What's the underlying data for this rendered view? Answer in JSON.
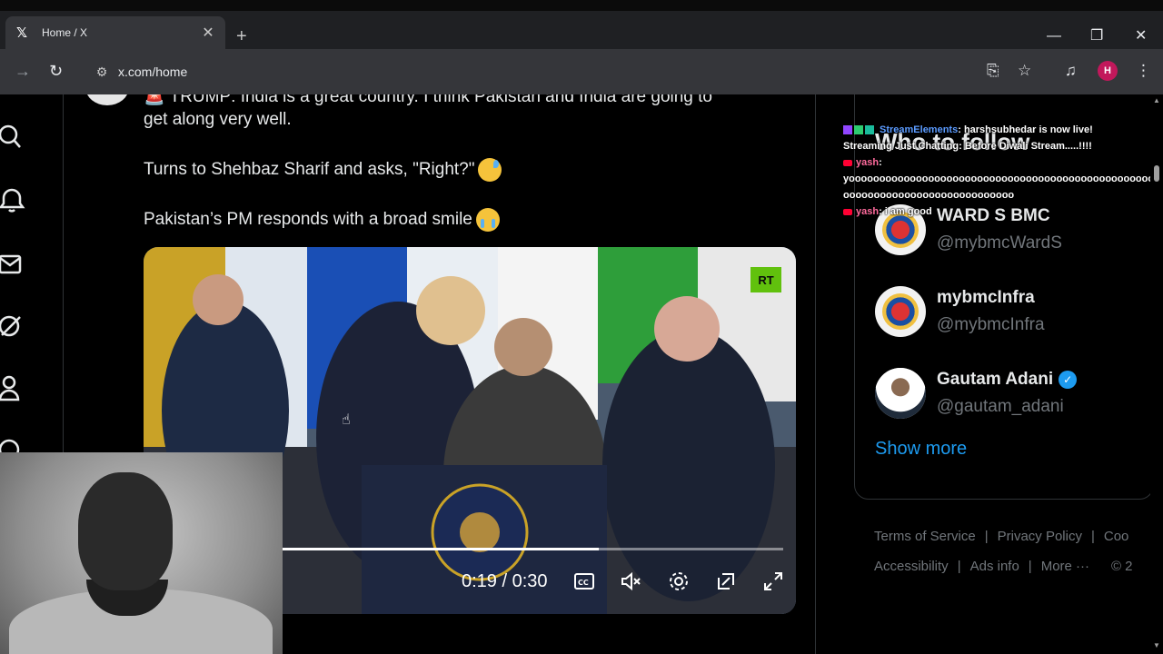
{
  "browser": {
    "tab_title": "Home / X",
    "tab_favicon": "x-logo-icon",
    "url": "x.com/home",
    "profile_initial": "H",
    "profile_color": "#c2185b"
  },
  "post": {
    "line1": "🚨 TRUMP: India is a great country. I think Pakistan and India are going to",
    "line2": "get along very well.",
    "line3": "Turns to Shehbaz Sharif and asks, \"Right?\"",
    "line4": "Pakistan’s PM responds with a broad smile",
    "video": {
      "badge": "RT",
      "time": "0:19 / 0:30",
      "progress": 0.633
    }
  },
  "chat": {
    "line1_source": "StreamElements",
    "line1_text": ": harshsubhedar is now live!",
    "line2": "Streaming Just Chatting: Before Diwali Stream.....!!!!",
    "line3_user": "yash",
    "line3_text": ":",
    "line4": "yoooooooooooooooooooooooooooooooooooooooooooooooooo",
    "line5": "oooooooooooooooooooooooooooo",
    "line6_user": "yash",
    "line6_text": ": i am good"
  },
  "sidebar": {
    "title": "Who to follow",
    "accounts": [
      {
        "name": "WARD S BMC",
        "handle": "@mybmcWardS",
        "verified": false
      },
      {
        "name": "mybmcInfra",
        "handle": "@mybmcInfra",
        "verified": false
      },
      {
        "name": "Gautam Adani",
        "handle": "@gautam_adani",
        "verified": true
      }
    ],
    "show_more": "Show more",
    "footer_row1": [
      "Terms of Service",
      "Privacy Policy",
      "Coo"
    ],
    "footer_row2": [
      "Accessibility",
      "Ads info",
      "More ···",
      "© 2"
    ]
  },
  "colors": {
    "accent": "#1d9bf0",
    "muted": "#71767b",
    "background": "#000000"
  }
}
